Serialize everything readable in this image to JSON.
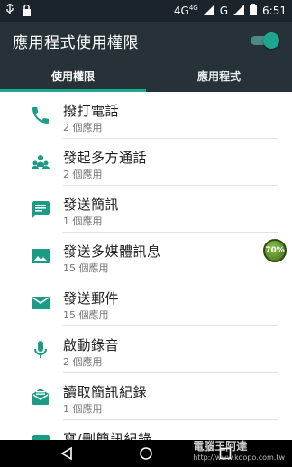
{
  "status_bar": {
    "network_label": "4G",
    "network_sub": "4G",
    "g_label": "G",
    "time": "6:51"
  },
  "toolbar": {
    "title": "應用程式使用權限",
    "toggle_on": true
  },
  "tabs": [
    {
      "label": "使用權限",
      "active": true
    },
    {
      "label": "應用程式",
      "active": false
    }
  ],
  "permissions": [
    {
      "icon": "phone-icon",
      "title": "撥打電話",
      "count": "2 個應用"
    },
    {
      "icon": "group-icon",
      "title": "發起多方通話",
      "count": "2 個應用"
    },
    {
      "icon": "message-icon",
      "title": "發送簡訊",
      "count": "1 個應用"
    },
    {
      "icon": "image-icon",
      "title": "發送多媒體訊息",
      "count": "15 個應用"
    },
    {
      "icon": "email-icon",
      "title": "發送郵件",
      "count": "15 個應用"
    },
    {
      "icon": "microphone-icon",
      "title": "啟動錄音",
      "count": "2 個應用"
    },
    {
      "icon": "read-sms-icon",
      "title": "讀取簡訊紀錄",
      "count": "1 個應用"
    },
    {
      "icon": "edit-sms-icon",
      "title": "寫/刪簡訊紀錄",
      "count": ""
    }
  ],
  "floating_badge": "70%",
  "watermark": {
    "line1": "電腦王阿達",
    "line2": "http://www.koopo.com.tw"
  },
  "colors": {
    "accent": "#1fa68f",
    "toolbar": "#263238",
    "statusbar": "#1b242b"
  }
}
